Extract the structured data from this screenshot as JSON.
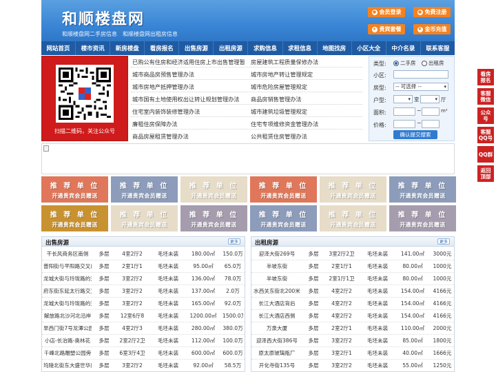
{
  "header": {
    "logo": "和顺楼盘网",
    "slogan": "和顺楼盘网二手房信息　和顺楼盘网出租房信息",
    "buttons": [
      "会员登录",
      "免费注册",
      "贵宾套餐",
      "金币充值"
    ]
  },
  "nav": [
    "网站首页",
    "楼市资讯",
    "新房楼盘",
    "看房报名",
    "出售房源",
    "出租房源",
    "求购信息",
    "求租信息",
    "地图找房",
    "小区大全",
    "中介名录",
    "联系客服"
  ],
  "qr": {
    "caption": "扫描二维码，关注公众号"
  },
  "links": {
    "left": [
      "已购公有住房和经济适用住房上市出售管理暂",
      "城市商品房预售管理办法",
      "城市房地产抵押管理办法",
      "城市国有土地使用权出让转让规划管理办法",
      "住宅室内装饰装修管理办法",
      "廉租住房保障办法",
      "商品房屋租赁管理办法"
    ],
    "right": [
      "房屋建筑工程质量保修办法",
      "城市房地产转让管理规定",
      "城市危险房屋管理规定",
      "商品房销售管理办法",
      "城市建筑垃圾管理规定",
      "住宅专项维修资金管理办法",
      "公共租赁住房管理办法"
    ]
  },
  "search": {
    "type_label": "类型:",
    "radio_sale": "二手房",
    "radio_rent": "出租房",
    "community_label": "小区:",
    "housetype_label": "房型:",
    "housetype_value": "-- 可选择 --",
    "layout_label": "户型:",
    "room_unit": "室",
    "hall_unit": "厅",
    "area_label": "面积:",
    "area_unit": "m²",
    "range_sep": "~",
    "price_label": "价格:",
    "submit": "确认提交搜索"
  },
  "ads": {
    "title": "推 荐 单 位",
    "sub": "开通贵宾会员赠送",
    "colors": [
      "#e0775a",
      "#8c9cba",
      "#e6dcc8",
      "#e0775a",
      "#e6dcc8",
      "#8c9cba",
      "#c99230",
      "#e6dcc8",
      "#a59cae",
      "#8c9cba",
      "#e6dcc8",
      "#a59cae"
    ]
  },
  "sale": {
    "title": "出售房源",
    "more": "更多",
    "rows": [
      [
        "干长风商务区南侧",
        "多层",
        "4室2厅2",
        "毛坯未装",
        "180.00㎡",
        "150.0万"
      ],
      [
        "普阳街与平阳路交叉口",
        "多层",
        "2室1厅1",
        "毛坯未装",
        "95.00㎡",
        "65.0万"
      ],
      [
        "龙城大街与玲珑路的交",
        "多层",
        "3室2厅2",
        "毛坯未装",
        "136.00㎡",
        "78.0万"
      ],
      [
        "府东街东延太行路交叉",
        "多层",
        "3室2厅2",
        "毛坯未装",
        "137.00㎡",
        "2.0万"
      ],
      [
        "龙城大街与玲珑路的交",
        "多层",
        "3室2厅2",
        "毛坯未装",
        "165.00㎡",
        "92.0万"
      ],
      [
        "解放路北沙河北沿岸",
        "多层",
        "12室6厅8",
        "毛坯未装",
        "1200.00㎡",
        "1500.0万"
      ],
      [
        "旱西门街7号龙潭公园",
        "多层",
        "4室2厅3",
        "毛坯未装",
        "280.00㎡",
        "380.0万"
      ],
      [
        "小店-长治路-奥林花",
        "多层",
        "2室2厅2卫",
        "毛坯未装",
        "112.00㎡",
        "100.0万"
      ],
      [
        "千峰北路雕塑公园旁",
        "多层",
        "6室3厅4卫",
        "毛坯未装",
        "600.00㎡",
        "600.0万"
      ],
      [
        "坞陵北街东大盛世华庭",
        "多层",
        "3室2厅2",
        "毛坯未装",
        "92.00㎡",
        "58.5万"
      ]
    ]
  },
  "rent": {
    "title": "出租房源",
    "more": "更多",
    "rows": [
      [
        "迎泽大街269号",
        "多层",
        "3室2厅2卫",
        "毛坯未装",
        "141.00㎡",
        "3000元"
      ],
      [
        "半坡东街",
        "多层",
        "2室1厅1",
        "毛坯未装",
        "80.00㎡",
        "1000元"
      ],
      [
        "半坡东街",
        "多层",
        "2室1厅1卫",
        "毛坯未装",
        "80.00㎡",
        "1000元"
      ],
      [
        "水西关东街北200米",
        "多层",
        "4室2厅2",
        "毛坯未装",
        "154.00㎡",
        "4166元"
      ],
      [
        "长江大酒店背后",
        "多层",
        "4室2厅2",
        "毛坯未装",
        "154.00㎡",
        "4166元"
      ],
      [
        "长江大酒店西侧",
        "多层",
        "4室2厅2",
        "毛坯未装",
        "154.00㎡",
        "4166元"
      ],
      [
        "万泉大厦",
        "多层",
        "2室2厅1",
        "毛坯未装",
        "110.00㎡",
        "2000元"
      ],
      [
        "迎泽西大街386号",
        "多层",
        "3室2厅2",
        "毛坯未装",
        "85.00㎡",
        "1800元"
      ],
      [
        "原太原玻璃瓶厂",
        "多层",
        "3室2厅1",
        "毛坯未装",
        "40.00㎡",
        "1666元"
      ],
      [
        "开化寺街135号",
        "多层",
        "3室2厅2",
        "毛坯未装",
        "55.00㎡",
        "1250元"
      ]
    ]
  },
  "sidebar": [
    "看房报名",
    "客服微信",
    "公众号",
    "客服QQ号",
    "QQ群",
    "返回顶部"
  ]
}
